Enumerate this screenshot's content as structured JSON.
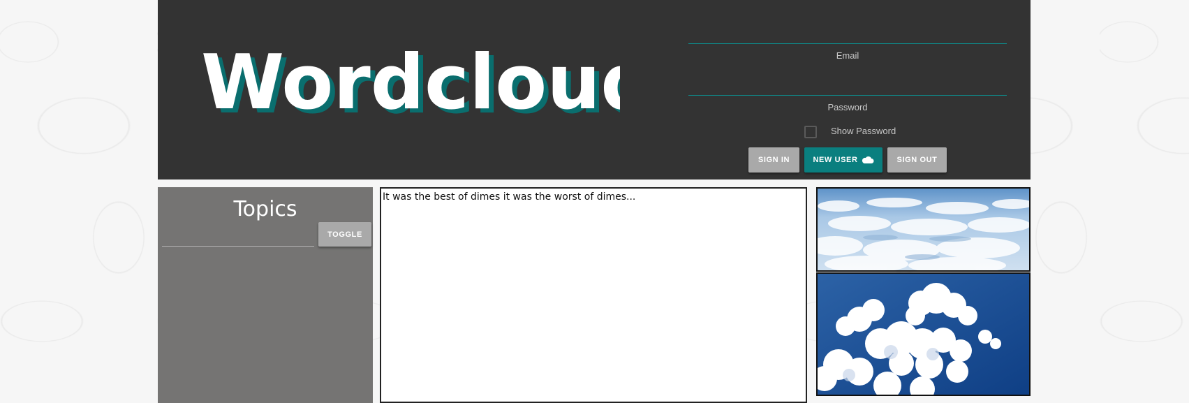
{
  "header": {
    "logo_text": "Wordcloud",
    "email_label": "Email",
    "password_label": "Password",
    "show_password_label": "Show Password",
    "show_password_checked": false,
    "buttons": {
      "sign_in": "SIGN IN",
      "new_user": "NEW USER",
      "sign_out": "SIGN OUT"
    }
  },
  "sidebar": {
    "title": "Topics",
    "toggle_label": "TOGGLE"
  },
  "editor": {
    "text": "It was the best of dimes it was the worst of dimes..."
  },
  "colors": {
    "header_bg": "#333333",
    "accent": "#0a7f7f",
    "sidebar_bg": "#757473",
    "button_grey": "#a9a9a9"
  }
}
